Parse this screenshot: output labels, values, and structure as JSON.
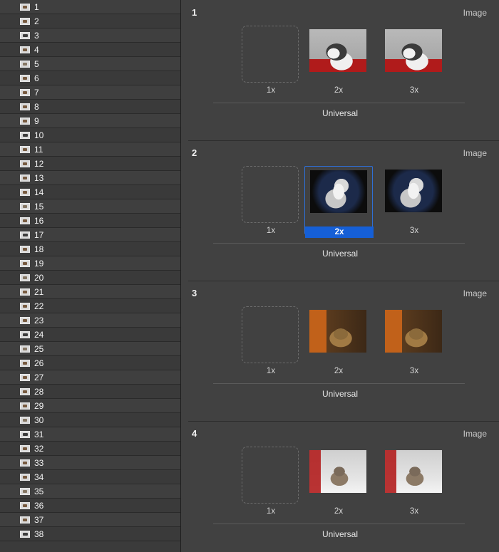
{
  "sidebar": {
    "items": [
      {
        "label": "1",
        "thumb": "cat"
      },
      {
        "label": "2",
        "thumb": "cat"
      },
      {
        "label": "3",
        "thumb": "cat"
      },
      {
        "label": "4",
        "thumb": "cat"
      },
      {
        "label": "5",
        "thumb": "cat"
      },
      {
        "label": "6",
        "thumb": "cat"
      },
      {
        "label": "7",
        "thumb": "cat"
      },
      {
        "label": "8",
        "thumb": "cat"
      },
      {
        "label": "9",
        "thumb": "cat"
      },
      {
        "label": "10",
        "thumb": "cat"
      },
      {
        "label": "11",
        "thumb": "cat"
      },
      {
        "label": "12",
        "thumb": "cat"
      },
      {
        "label": "13",
        "thumb": "cat"
      },
      {
        "label": "14",
        "thumb": "cat"
      },
      {
        "label": "15",
        "thumb": "cat"
      },
      {
        "label": "16",
        "thumb": "cat"
      },
      {
        "label": "17",
        "thumb": "cat"
      },
      {
        "label": "18",
        "thumb": "cat"
      },
      {
        "label": "19",
        "thumb": "cat"
      },
      {
        "label": "20",
        "thumb": "cat"
      },
      {
        "label": "21",
        "thumb": "cat"
      },
      {
        "label": "22",
        "thumb": "cat"
      },
      {
        "label": "23",
        "thumb": "cat"
      },
      {
        "label": "24",
        "thumb": "cat"
      },
      {
        "label": "25",
        "thumb": "cat"
      },
      {
        "label": "26",
        "thumb": "cat"
      },
      {
        "label": "27",
        "thumb": "cat"
      },
      {
        "label": "28",
        "thumb": "cat"
      },
      {
        "label": "29",
        "thumb": "cat"
      },
      {
        "label": "30",
        "thumb": "cat"
      },
      {
        "label": "31",
        "thumb": "cat"
      },
      {
        "label": "32",
        "thumb": "cat"
      },
      {
        "label": "33",
        "thumb": "cat"
      },
      {
        "label": "34",
        "thumb": "cat"
      },
      {
        "label": "35",
        "thumb": "cat"
      },
      {
        "label": "36",
        "thumb": "cat"
      },
      {
        "label": "37",
        "thumb": "cat"
      },
      {
        "label": "38",
        "thumb": "cat"
      }
    ]
  },
  "main": {
    "groups": [
      {
        "number": "1",
        "type": "Image",
        "scales": [
          {
            "label": "1x",
            "state": "empty"
          },
          {
            "label": "2x",
            "state": "filled",
            "image": "cat1"
          },
          {
            "label": "3x",
            "state": "filled",
            "image": "cat1"
          }
        ],
        "idiom": "Universal"
      },
      {
        "number": "2",
        "type": "Image",
        "scales": [
          {
            "label": "1x",
            "state": "empty"
          },
          {
            "label": "2x",
            "state": "selected",
            "image": "cat2"
          },
          {
            "label": "3x",
            "state": "filled",
            "image": "cat2"
          }
        ],
        "idiom": "Universal"
      },
      {
        "number": "3",
        "type": "Image",
        "scales": [
          {
            "label": "1x",
            "state": "empty"
          },
          {
            "label": "2x",
            "state": "filled",
            "image": "cat3"
          },
          {
            "label": "3x",
            "state": "filled",
            "image": "cat3"
          }
        ],
        "idiom": "Universal"
      },
      {
        "number": "4",
        "type": "Image",
        "scales": [
          {
            "label": "1x",
            "state": "empty"
          },
          {
            "label": "2x",
            "state": "filled",
            "image": "cat4"
          },
          {
            "label": "3x",
            "state": "filled",
            "image": "cat4"
          }
        ],
        "idiom": "Universal"
      }
    ]
  },
  "colors": {
    "selection_blue": "#155fd6",
    "selection_border": "#2f6fd6"
  }
}
